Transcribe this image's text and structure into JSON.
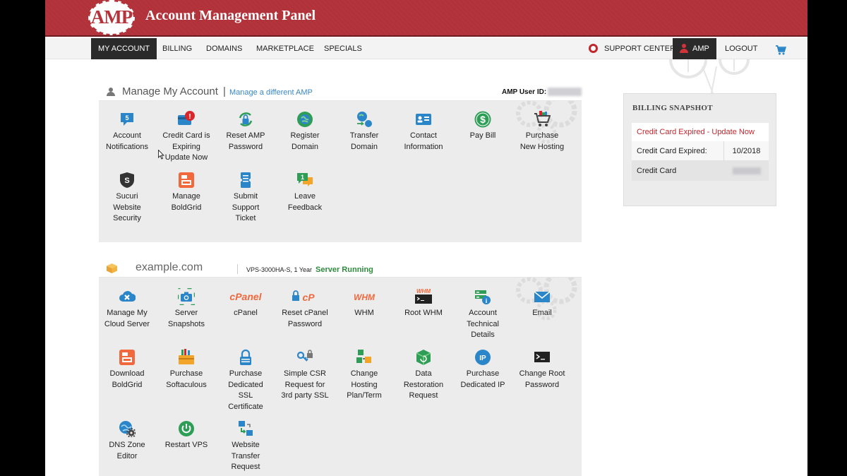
{
  "header": {
    "logo_text": "AMP",
    "title": "Account Management Panel"
  },
  "nav": {
    "my_account": "MY ACCOUNT",
    "billing": "BILLING",
    "domains": "DOMAINS",
    "marketplace": "MARKETPLACE",
    "specials": "SPECIALS",
    "support_center": "SUPPORT CENTER",
    "amp": "AMP",
    "logout": "LOGOUT"
  },
  "account_panel": {
    "title": "Manage My Account",
    "separator": "|",
    "manage_link": "Manage a different AMP",
    "user_id_label": "AMP User ID:",
    "tiles": [
      {
        "name": "account-notifications",
        "icon": "notification-badge-icon",
        "badge": "5",
        "label": [
          "Account",
          "Notifications"
        ]
      },
      {
        "name": "credit-card-expiring",
        "icon": "credit-card-alert-icon",
        "badge": "!",
        "label": [
          "Credit Card is",
          "Expiring",
          "Update Now"
        ]
      },
      {
        "name": "reset-amp-password",
        "icon": "lock-refresh-icon",
        "label": [
          "Reset AMP",
          "Password"
        ]
      },
      {
        "name": "register-domain",
        "icon": "globe-icon",
        "label": [
          "Register",
          "Domain"
        ]
      },
      {
        "name": "transfer-domain",
        "icon": "globe-transfer-icon",
        "label": [
          "Transfer",
          "Domain"
        ]
      },
      {
        "name": "contact-information",
        "icon": "contact-card-icon",
        "label": [
          "Contact",
          "Information"
        ]
      },
      {
        "name": "pay-bill",
        "icon": "dollar-icon",
        "badge": "$",
        "label": [
          "Pay Bill"
        ]
      },
      {
        "name": "purchase-new-hosting",
        "icon": "shopping-cart-icon",
        "label": [
          "Purchase",
          "New Hosting"
        ]
      },
      {
        "name": "sucuri-website-security",
        "icon": "shield-icon",
        "badge": "S",
        "label": [
          "Sucuri",
          "Website",
          "Security"
        ]
      },
      {
        "name": "manage-boldgrid",
        "icon": "boldgrid-icon",
        "label": [
          "Manage",
          "BoldGrid"
        ]
      },
      {
        "name": "submit-support-ticket",
        "icon": "ticket-icon",
        "label": [
          "Submit",
          "Support",
          "Ticket"
        ]
      },
      {
        "name": "leave-feedback",
        "icon": "chat-bubbles-icon",
        "badge": "1",
        "label": [
          "Leave",
          "Feedback"
        ]
      }
    ]
  },
  "server_panel": {
    "domain": "example.com",
    "plan": "VPS-3000HA-S, 1 Year",
    "status": "Server Running",
    "tiles": [
      {
        "name": "manage-cloud-server",
        "icon": "cloud-tools-icon",
        "label": [
          "Manage My",
          "Cloud Server"
        ]
      },
      {
        "name": "server-snapshots",
        "icon": "camera-icon",
        "label": [
          "Server",
          "Snapshots"
        ]
      },
      {
        "name": "cpanel",
        "icon": "cpanel-icon",
        "logo": "cPanel",
        "label": [
          "cPanel"
        ]
      },
      {
        "name": "reset-cpanel-password",
        "icon": "cpanel-lock-icon",
        "logo": "cP",
        "label": [
          "Reset cPanel",
          "Password"
        ]
      },
      {
        "name": "whm",
        "icon": "whm-icon",
        "logo": "WHM",
        "label": [
          "WHM"
        ]
      },
      {
        "name": "root-whm",
        "icon": "root-whm-icon",
        "logo": "WHM",
        "label": [
          "Root WHM"
        ]
      },
      {
        "name": "account-technical-details",
        "icon": "server-info-icon",
        "label": [
          "Account",
          "Technical",
          "Details"
        ]
      },
      {
        "name": "email",
        "icon": "envelope-icon",
        "label": [
          "Email"
        ]
      },
      {
        "name": "download-boldgrid",
        "icon": "boldgrid-icon",
        "label": [
          "Download",
          "BoldGrid"
        ]
      },
      {
        "name": "purchase-softaculous",
        "icon": "toolbox-icon",
        "label": [
          "Purchase",
          "Softaculous"
        ]
      },
      {
        "name": "purchase-dedicated-ssl",
        "icon": "padlock-icon",
        "label": [
          "Purchase",
          "Dedicated",
          "SSL",
          "Certificate"
        ]
      },
      {
        "name": "simple-csr-request",
        "icon": "key-lock-icon",
        "label": [
          "Simple CSR",
          "Request for",
          "3rd party SSL"
        ]
      },
      {
        "name": "change-hosting-plan",
        "icon": "cubes-icon",
        "label": [
          "Change",
          "Hosting",
          "Plan/Term"
        ]
      },
      {
        "name": "data-restoration-request",
        "icon": "cube-restore-icon",
        "label": [
          "Data",
          "Restoration",
          "Request"
        ]
      },
      {
        "name": "purchase-dedicated-ip",
        "icon": "ip-icon",
        "logo": "IP",
        "label": [
          "Purchase",
          "Dedicated IP"
        ]
      },
      {
        "name": "change-root-password",
        "icon": "terminal-icon",
        "label": [
          "Change Root",
          "Password"
        ]
      },
      {
        "name": "dns-zone-editor",
        "icon": "globe-gear-icon",
        "label": [
          "DNS Zone",
          "Editor"
        ]
      },
      {
        "name": "restart-vps",
        "icon": "power-icon",
        "label": [
          "Restart VPS"
        ]
      },
      {
        "name": "website-transfer-request",
        "icon": "website-transfer-icon",
        "label": [
          "Website",
          "Transfer",
          "Request"
        ]
      }
    ]
  },
  "billing_snapshot": {
    "title": "BILLING SNAPSHOT",
    "alert": "Credit Card Expired - Update Now",
    "expired_label": "Credit Card Expired:",
    "expired_value": "10/2018",
    "card_label": "Credit Card"
  },
  "colors": {
    "brand_red": "#b5343c",
    "link_blue": "#3a87c6",
    "status_green": "#2e8b3c",
    "alert_red": "#c4262d"
  }
}
